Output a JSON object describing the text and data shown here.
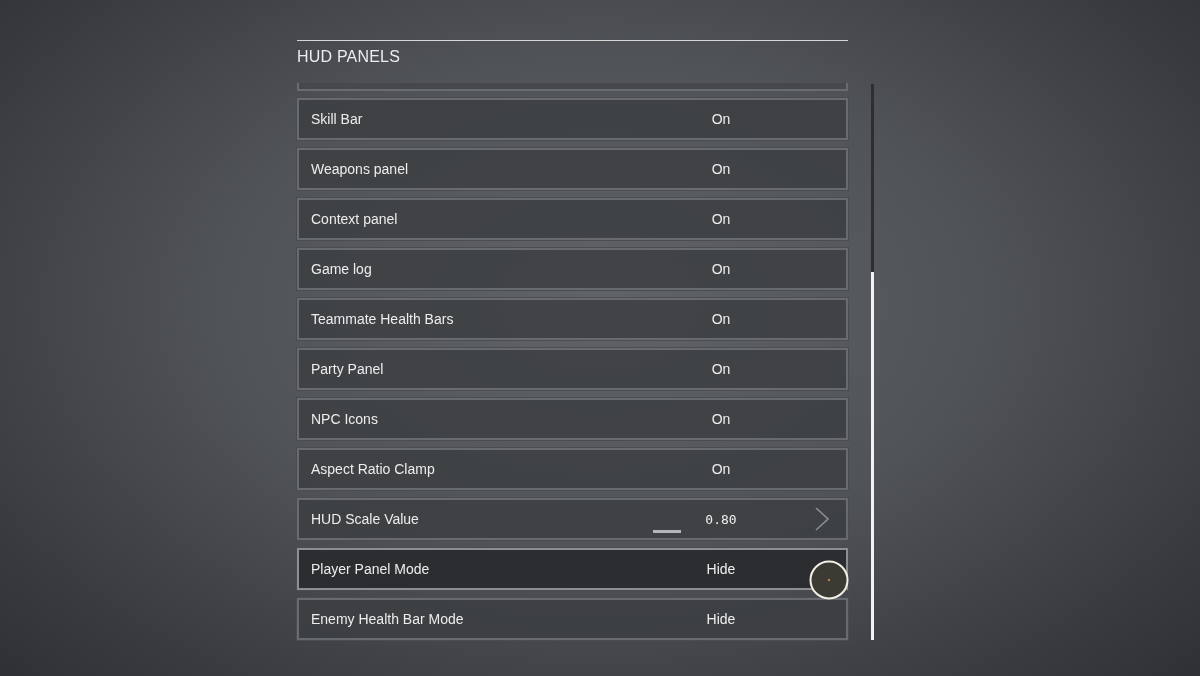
{
  "section": {
    "title": "HUD PANELS"
  },
  "settings": [
    {
      "label": "Skill Bar",
      "value": "On",
      "kind": "option",
      "selected": false
    },
    {
      "label": "Weapons panel",
      "value": "On",
      "kind": "option",
      "selected": false
    },
    {
      "label": "Context panel",
      "value": "On",
      "kind": "option",
      "selected": false
    },
    {
      "label": "Game log",
      "value": "On",
      "kind": "option",
      "selected": false
    },
    {
      "label": "Teammate Health Bars",
      "value": "On",
      "kind": "option",
      "selected": false
    },
    {
      "label": "Party Panel",
      "value": "On",
      "kind": "option",
      "selected": false
    },
    {
      "label": "NPC Icons",
      "value": "On",
      "kind": "option",
      "selected": false
    },
    {
      "label": "Aspect Ratio Clamp",
      "value": "On",
      "kind": "option",
      "selected": false
    },
    {
      "label": "HUD Scale Value",
      "value": "0.80",
      "kind": "stepper",
      "selected": false
    },
    {
      "label": "Player Panel Mode",
      "value": "Hide",
      "kind": "option",
      "selected": true
    },
    {
      "label": "Enemy Health Bar Mode",
      "value": "Hide",
      "kind": "option",
      "selected": false
    }
  ]
}
